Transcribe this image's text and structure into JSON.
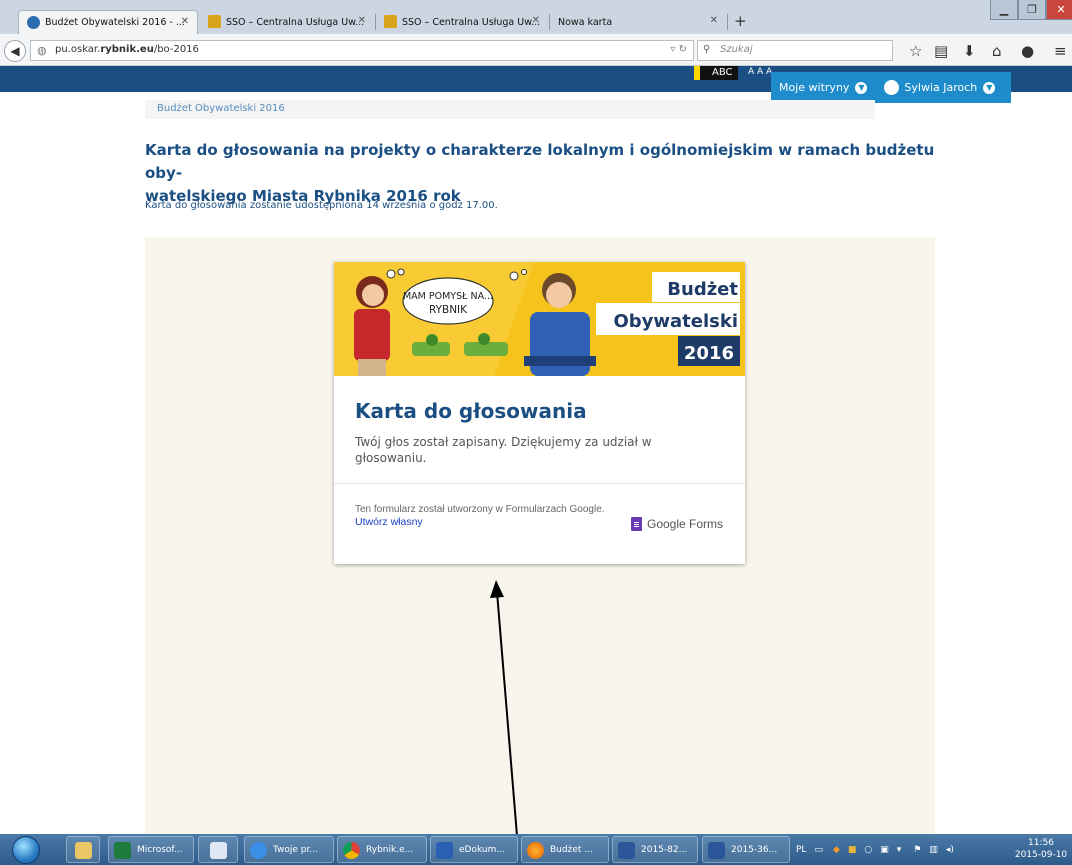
{
  "browser": {
    "tabs": [
      {
        "label": "Budżet Obywatelski 2016 - ...",
        "active": true
      },
      {
        "label": "SSO – Centralna Usługa Uw..."
      },
      {
        "label": "SSO – Centralna Usługa Uw..."
      },
      {
        "label": "Nowa karta"
      }
    ],
    "url_prefix": "pu.oskar.",
    "url_domain": "rybnik.eu",
    "url_path": "/bo-2016",
    "search_placeholder": "Szukaj"
  },
  "site_header": {
    "contrast_label": "ABC",
    "font_size_label": "A A A",
    "my_sites": "Moje witryny",
    "user_name": "Sylwia Jaroch"
  },
  "page": {
    "breadcrumb": "Budżet Obywatelski 2016",
    "title_line1": "Karta do głosowania na projekty o charakterze lokalnym i ogólnomiejskim  w ramach budżetu oby-",
    "title_line2": "watelskiego Miasta Rybnika 2016 rok",
    "subtitle": "Karta do głosowania zostanie udostępniona  14 września o godz 17.00."
  },
  "form_card": {
    "banner_bubble_line1": "MAM POMYSŁ NA...",
    "banner_bubble_line2": "RYBNIK",
    "banner_brand_line1": "Budżet",
    "banner_brand_line2": "Obywatelski",
    "banner_year": "2016",
    "title": "Karta do głosowania",
    "message": "Twój głos został zapisany. Dziękujemy za udział w głosowaniu.",
    "footer_text": "Ten formularz został utworzony w Formularzach Google.",
    "footer_link": "Utwórz własny",
    "brand": "Google Forms"
  },
  "taskbar": {
    "buttons": [
      "Microsof...",
      "",
      "Twoje pr...",
      "Rybnik.e...",
      "eDokum...",
      "Budżet ...",
      "2015-82...",
      "2015-36..."
    ],
    "language": "PL",
    "time": "11:56",
    "date": "2015-09-10"
  },
  "colors": {
    "site_header": "#1b4f83",
    "user_menu": "#1e8ccb",
    "page_background_panel": "#f8f6ec",
    "banner_yellow": "#f6c21c",
    "banner_navy": "#1e3a66"
  }
}
